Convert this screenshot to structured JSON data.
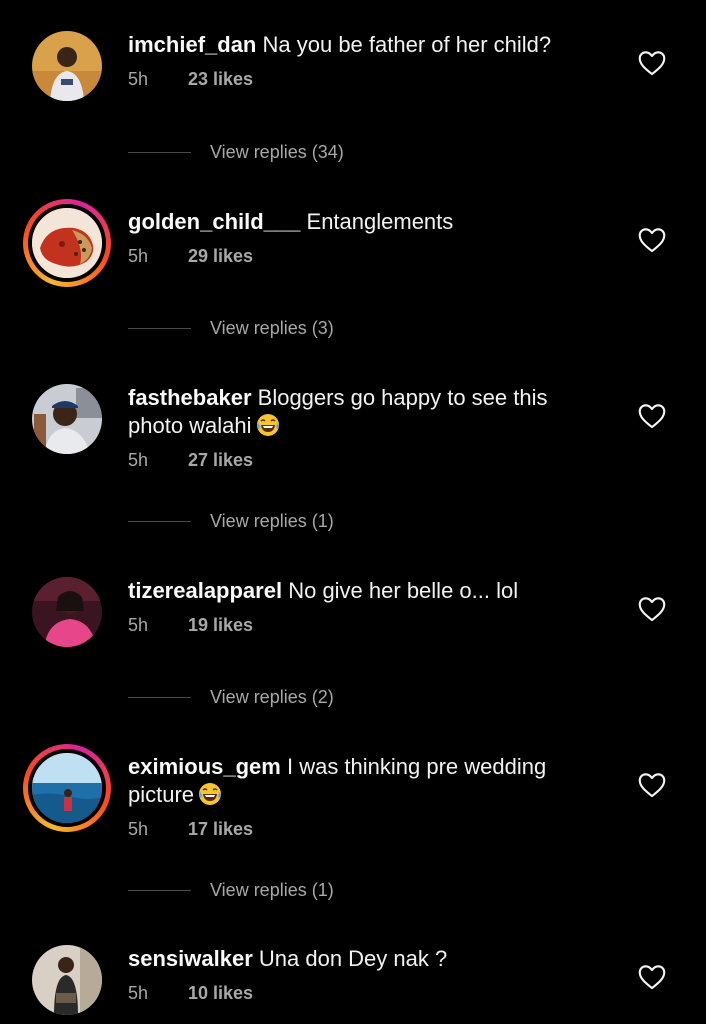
{
  "comments": [
    {
      "username": "imchief_dan",
      "text": "Na you be father of her child?",
      "time": "5h",
      "likes": "23 likes",
      "view_replies": "View replies (34)",
      "story_ring": false
    },
    {
      "username": "golden_child___",
      "text": "Entanglements",
      "time": "5h",
      "likes": "29 likes",
      "view_replies": "View replies (3)",
      "story_ring": true
    },
    {
      "username": "fasthebaker",
      "text": "Bloggers go happy to see this",
      "text_line2": "photo walahi",
      "time": "5h",
      "likes": "27 likes",
      "view_replies": "View replies (1)",
      "story_ring": false
    },
    {
      "username": "tizerealapparel",
      "text": "No give her belle o... lol",
      "time": "5h",
      "likes": "19 likes",
      "view_replies": "View replies (2)",
      "story_ring": false
    },
    {
      "username": "eximious_gem",
      "text": "I was thinking pre wedding",
      "text_line2": "picture",
      "time": "5h",
      "likes": "17 likes",
      "view_replies": "View replies (1)",
      "story_ring": true
    },
    {
      "username": "sensiwalker",
      "text": "Una don Dey nak ?",
      "time": "5h",
      "likes": "10 likes",
      "story_ring": false
    }
  ],
  "icons": {
    "like": "heart-outline-icon",
    "laugh_emoji": "face-with-tears-of-joy"
  },
  "colors": {
    "background": "#000000",
    "primary_text": "#f5f5f5",
    "secondary_text": "#a8a8a8",
    "story_ring_gradient": [
      "#f7b733",
      "#fc4a1a",
      "#d6249f"
    ]
  }
}
